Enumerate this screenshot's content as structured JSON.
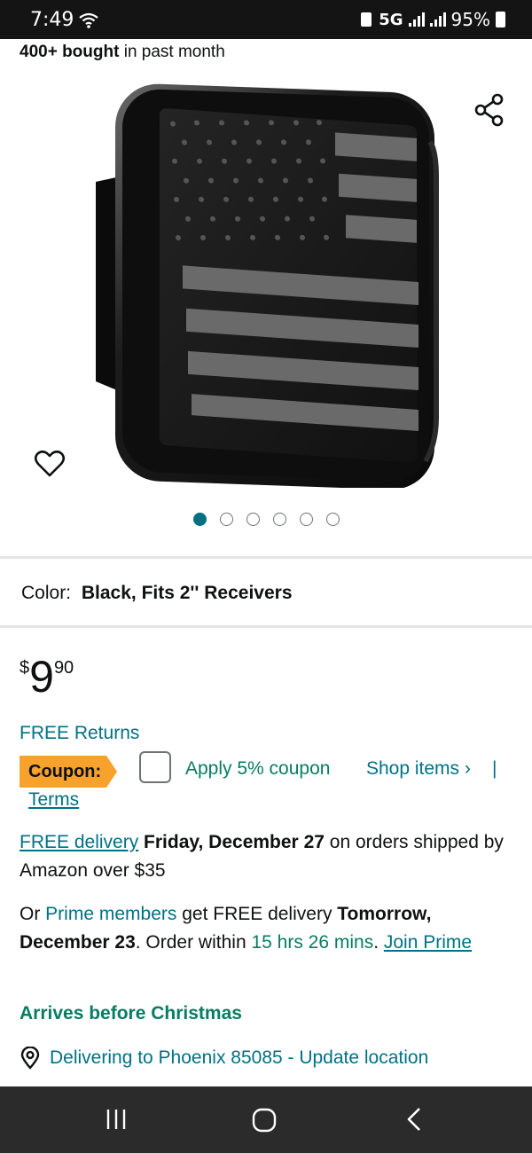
{
  "status": {
    "time": "7:49",
    "network": "5G",
    "battery": "95%"
  },
  "product": {
    "bought": "400+ bought",
    "bought_suffix": " in past month",
    "image_alt": "Black American flag trailer hitch cover"
  },
  "carousel": {
    "count": 6,
    "active_index": 0
  },
  "color": {
    "label": "Color:",
    "value": "Black, Fits 2'' Receivers"
  },
  "price": {
    "symbol": "$",
    "whole": "9",
    "fraction": "90"
  },
  "returns": "FREE Returns",
  "coupon": {
    "badge": "Coupon:",
    "apply": "Apply 5% coupon",
    "shop": "Shop items ›",
    "pipe": "|",
    "terms": "Terms"
  },
  "delivery": {
    "free_link": "FREE delivery",
    "date": "Friday, December 27",
    "text1": " on orders shipped by Amazon over $35"
  },
  "prime": {
    "or": "Or ",
    "members_link": "Prime members",
    "get": " get FREE delivery ",
    "date": "Tomorrow, December 23",
    "order": ". Order within ",
    "countdown": "15 hrs 26 mins",
    "dot": ". ",
    "join_link": "Join Prime"
  },
  "arrives": "Arrives before Christmas",
  "location": "Delivering to Phoenix 85085 - Update location",
  "colors": {
    "teal": "#007185",
    "green": "#067d62",
    "coupon_orange": "#f7a22c"
  }
}
